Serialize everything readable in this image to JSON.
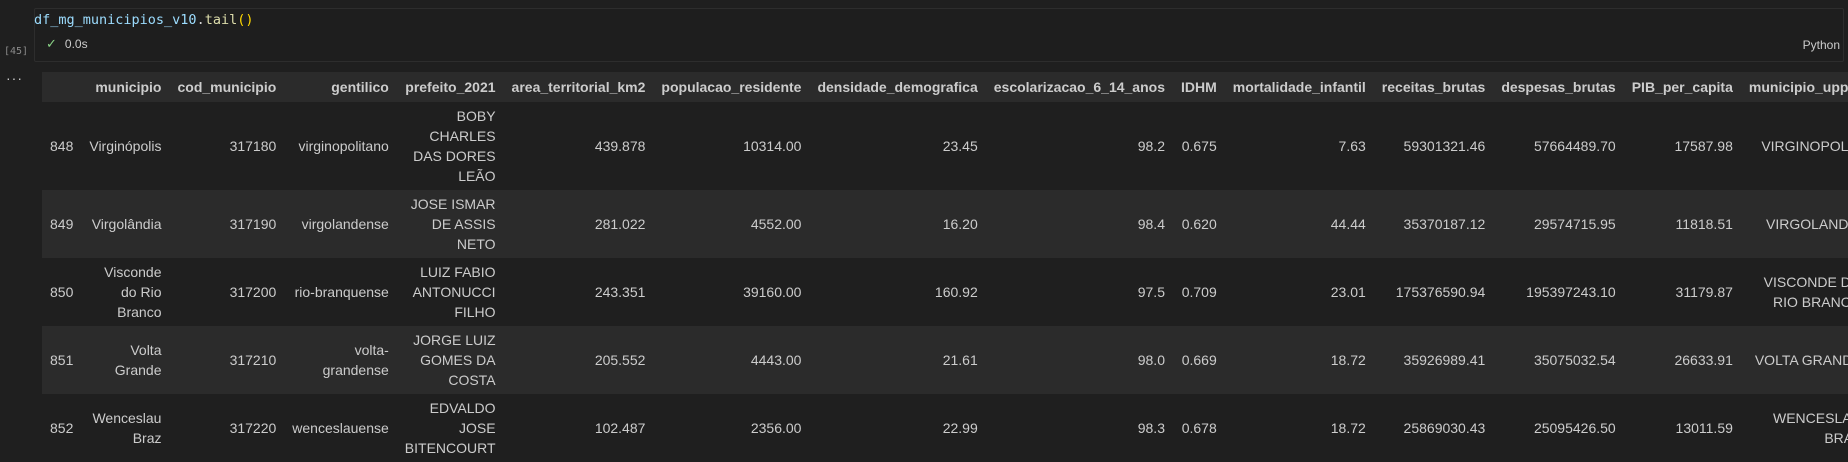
{
  "cell": {
    "execution_count": "[45]",
    "code": {
      "var": "df_mg_municipios_v10",
      "dot": ".",
      "fn": "tail",
      "parens": "()"
    },
    "status_time": "0.0s",
    "language": "Python"
  },
  "table": {
    "columns": [
      "",
      "municipio",
      "cod_municipio",
      "gentilico",
      "prefeito_2021",
      "area_territorial_km2",
      "populacao_residente",
      "densidade_demografica",
      "escolarizacao_6_14_anos",
      "IDHM",
      "mortalidade_infantil",
      "receitas_brutas",
      "despesas_brutas",
      "PIB_per_capita",
      "municipio_upper"
    ],
    "rows": [
      [
        "848",
        "Virginópolis",
        "317180",
        "virginopolitano",
        "BOBY CHARLES DAS DORES LEÃO",
        "439.878",
        "10314.00",
        "23.45",
        "98.2",
        "0.675",
        "7.63",
        "59301321.46",
        "57664489.70",
        "17587.98",
        "VIRGINOPOLIS"
      ],
      [
        "849",
        "Virgolândia",
        "317190",
        "virgolandense",
        "JOSE ISMAR DE ASSIS NETO",
        "281.022",
        "4552.00",
        "16.20",
        "98.4",
        "0.620",
        "44.44",
        "35370187.12",
        "29574715.95",
        "11818.51",
        "VIRGOLANDIA"
      ],
      [
        "850",
        "Visconde do Rio Branco",
        "317200",
        "rio-branquense",
        "LUIZ FABIO ANTONUCCI FILHO",
        "243.351",
        "39160.00",
        "160.92",
        "97.5",
        "0.709",
        "23.01",
        "175376590.94",
        "195397243.10",
        "31179.87",
        "VISCONDE DO RIO BRANCO"
      ],
      [
        "851",
        "Volta Grande",
        "317210",
        "volta-grandense",
        "JORGE LUIZ GOMES DA COSTA",
        "205.552",
        "4443.00",
        "21.61",
        "98.0",
        "0.669",
        "18.72",
        "35926989.41",
        "35075032.54",
        "26633.91",
        "VOLTA GRANDE"
      ],
      [
        "852",
        "Wenceslau Braz",
        "317220",
        "wenceslauense",
        "EDVALDO JOSE BITENCOURT",
        "102.487",
        "2356.00",
        "22.99",
        "98.3",
        "0.678",
        "18.72",
        "25869030.43",
        "25095426.50",
        "13011.59",
        "WENCESLAU BRAZ"
      ]
    ]
  }
}
